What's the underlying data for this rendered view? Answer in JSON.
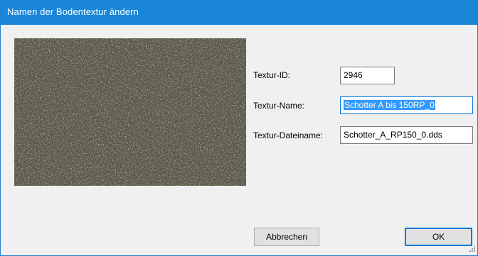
{
  "dialog": {
    "title": "Namen der Bodentextur ändern"
  },
  "preview": {
    "icon": "gravel-texture-preview",
    "colors": {
      "base": "#4e4b3d",
      "dark": "#2e2c24",
      "light": "#8c8a78",
      "green": "#4f6a3a"
    }
  },
  "form": {
    "id_label": "Textur-ID:",
    "id_value": "2946",
    "name_label": "Textur-Name:",
    "name_value": "Schotter A bis 150RP_0",
    "file_label": "Textur-Dateiname:",
    "file_value": "Schotter_A_RP150_0.dds"
  },
  "buttons": {
    "cancel_label": "Abbrechen",
    "ok_label": "OK"
  },
  "colors": {
    "titlebar": "#1a86d8",
    "selection": "#3399ff",
    "focus": "#0078d7"
  }
}
